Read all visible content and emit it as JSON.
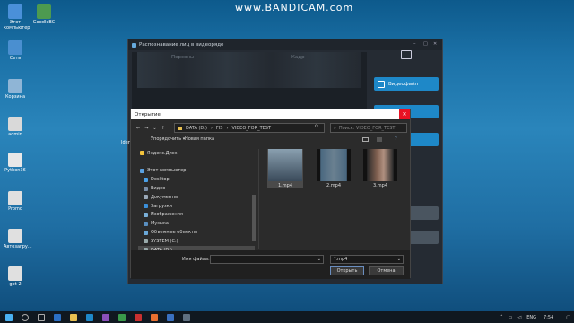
{
  "watermark": "www.BANDICAM.com",
  "desktop_icons": [
    {
      "label": "Этот компьютер",
      "color": "#4a90d9"
    },
    {
      "label": "GoodleBC",
      "color": "#4d9a50"
    },
    {
      "label": "Сеть",
      "color": "#4a8fd0"
    },
    {
      "label": "Корзина",
      "color": "#8fb5d6"
    },
    {
      "label": "admin",
      "color": "#d9d9d9"
    },
    {
      "label": "Python36",
      "color": "#e8e8e8"
    },
    {
      "label": "Promo",
      "color": "#e0e0e0"
    },
    {
      "label": "Автозагру...",
      "color": "#e0e0e0"
    },
    {
      "label": "gpt-2",
      "color": "#e0e0e0"
    }
  ],
  "app": {
    "title": "Распознавание лиц в видеоряде",
    "header_left": "Персоны",
    "header_right": "Кадр",
    "buttons": [
      {
        "label": "Видеофайл",
        "color": "#1e88c8"
      },
      {
        "label": "камера",
        "color": "#1e88c8"
      },
      {
        "label": "мера",
        "color": "#1e88c8"
      },
      {
        "label": "ниц",
        "color": "#4a5560"
      },
      {
        "label": "еть",
        "color": "#4a5560"
      }
    ],
    "left_label": "Iden"
  },
  "dialog": {
    "title": "Открытие",
    "close": "✕",
    "path_segments": [
      "DATA (D:)",
      "FIS",
      "VIDEO_FOR_TEST"
    ],
    "search_placeholder": "Поиск: VIDEO_FOR_TEST",
    "organize": "Упорядочить ▾",
    "new_folder": "Новая папка",
    "tree": [
      {
        "label": "Яндекс.Диск",
        "color": "#f3c33c"
      },
      {
        "label": "",
        "color": ""
      },
      {
        "label": "Этот компьютер",
        "color": "#5aa0e0"
      },
      {
        "label": "Desktop",
        "color": "#4aa0e8"
      },
      {
        "label": "Видео",
        "color": "#7a8ea8"
      },
      {
        "label": "Документы",
        "color": "#9aa8b8"
      },
      {
        "label": "Загрузки",
        "color": "#3b8fd9"
      },
      {
        "label": "Изображения",
        "color": "#7ab0d8"
      },
      {
        "label": "Музыка",
        "color": "#5a8fc0"
      },
      {
        "label": "Объемные объекты",
        "color": "#6aa8d8"
      },
      {
        "label": "SYSTEM (C:)",
        "color": "#9aa"
      },
      {
        "label": "DATA (D:)",
        "color": "#9aa"
      }
    ],
    "files": [
      {
        "name": "1.mp4",
        "selected": true
      },
      {
        "name": "2.mp4",
        "selected": false
      },
      {
        "name": "3.mp4",
        "selected": false
      }
    ],
    "filename_label": "Имя файла:",
    "filename_value": "",
    "filter_value": "*.mp4",
    "open_label": "Открыть",
    "cancel_label": "Отмена"
  },
  "taskbar": {
    "lang": "ENG",
    "time": "7:54"
  }
}
